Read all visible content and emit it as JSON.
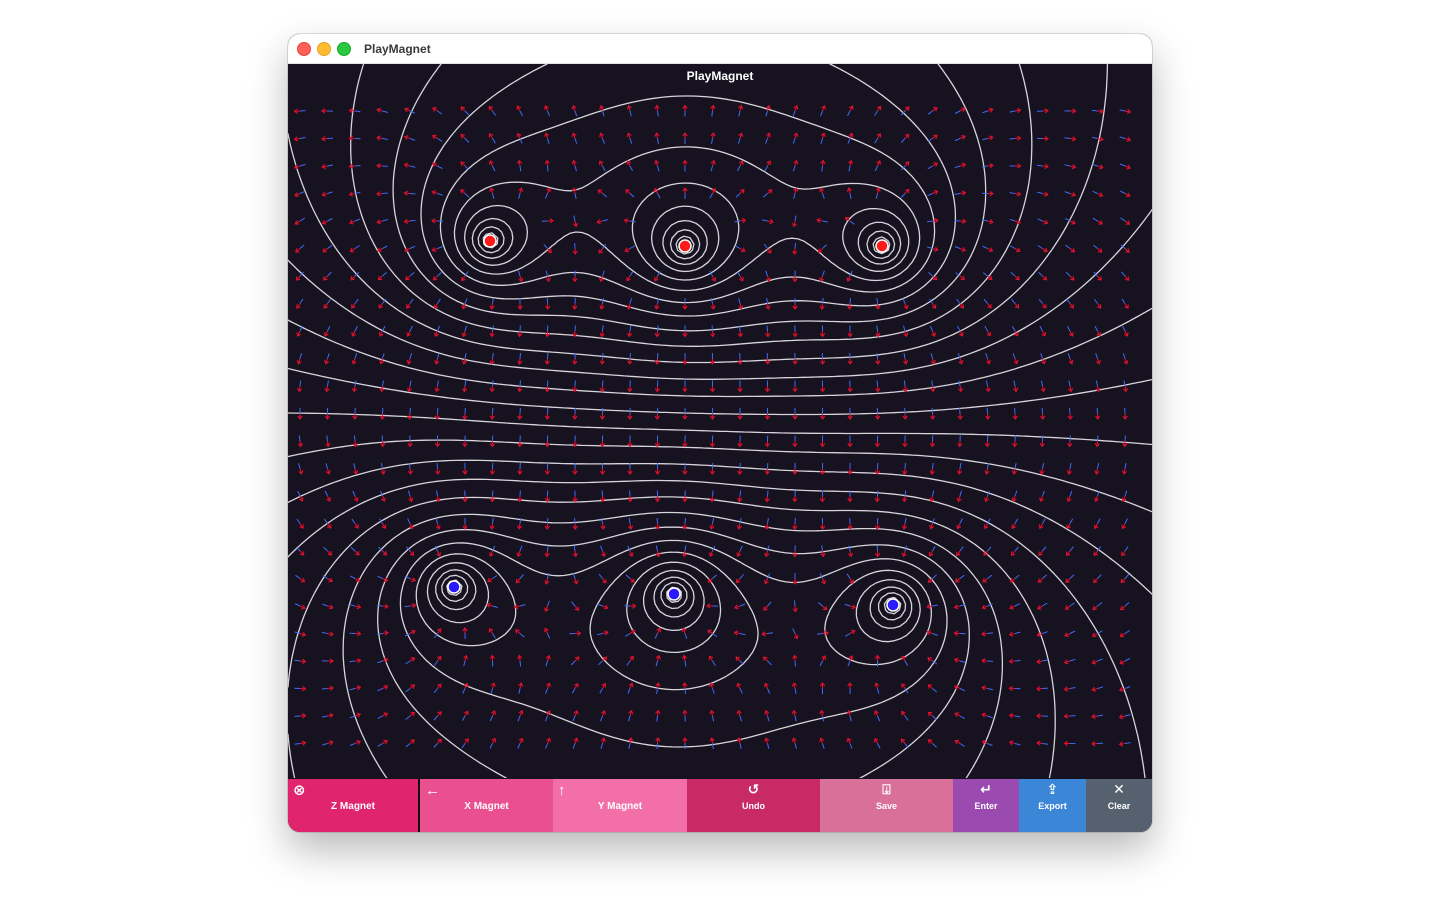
{
  "window": {
    "title": "PlayMagnet"
  },
  "app": {
    "title": "PlayMagnet"
  },
  "magnets": [
    {
      "pole": "north",
      "color": "#ff1a1a"
    },
    {
      "pole": "north",
      "color": "#ff1a1a"
    },
    {
      "pole": "north",
      "color": "#ff1a1a"
    },
    {
      "pole": "south",
      "color": "#2a1aff"
    },
    {
      "pole": "south",
      "color": "#2a1aff"
    },
    {
      "pole": "south",
      "color": "#2a1aff"
    }
  ],
  "colors": {
    "background": "#16121f",
    "field_lines": "#d8d4dc",
    "arrow_head": "#e0102f",
    "arrow_tail": "#3a6cff"
  },
  "toolbar": [
    {
      "label": "Z Magnet",
      "icon": "circle-x-icon",
      "color": "#e0246e",
      "selected": true
    },
    {
      "label": "X Magnet",
      "icon": "arrow-left-icon",
      "color": "#ea4f8f",
      "selected": false
    },
    {
      "label": "Y Magnet",
      "icon": "arrow-up-icon",
      "color": "#f26fa8",
      "selected": false
    },
    {
      "label": "Undo",
      "icon": "undo-icon",
      "color": "#c82a66",
      "selected": false
    },
    {
      "label": "Save",
      "icon": "save-icon",
      "color": "#d9709a",
      "selected": false
    },
    {
      "label": "Enter",
      "icon": "enter-icon",
      "color": "#9b4bb0",
      "selected": false
    },
    {
      "label": "Export",
      "icon": "share-icon",
      "color": "#3b86d6",
      "selected": false
    },
    {
      "label": "Clear",
      "icon": "close-icon",
      "color": "#566170",
      "selected": false
    }
  ]
}
